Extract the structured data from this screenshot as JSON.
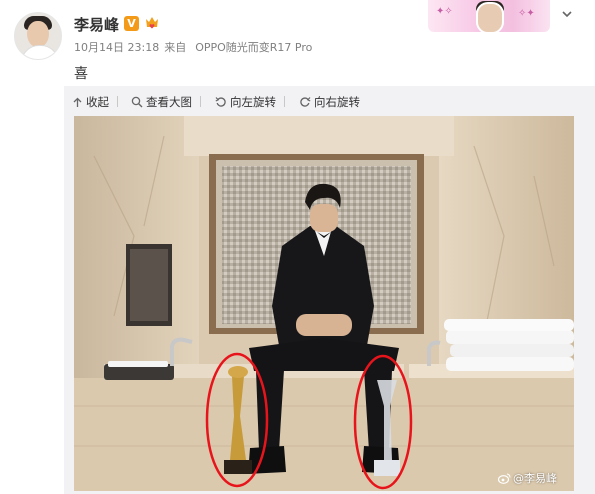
{
  "post": {
    "author_name": "李易峰",
    "verified_badge": "V",
    "timestamp": "10月14日 23:18",
    "source_prefix": "来自",
    "source": "OPPO随光而变R17 Pro",
    "text": "喜"
  },
  "icons": {
    "verified": "verified-v-icon",
    "vip": "crown-heart-icon",
    "more": "chevron-down-icon",
    "collapse": "arrow-up-icon",
    "view_large": "magnifier-icon",
    "rotate_left": "rotate-left-icon",
    "rotate_right": "rotate-right-icon",
    "watermark_logo": "weibo-logo-icon"
  },
  "toolbar": {
    "collapse": "收起",
    "view_large": "查看大图",
    "rotate_left": "向左旋转",
    "rotate_right": "向右旋转"
  },
  "photo": {
    "watermark": "@李易峰",
    "annotation_color": "#e8141c"
  },
  "colors": {
    "badge_orange": "#f39b19",
    "meta_gray": "#808080",
    "text": "#333333",
    "media_bg": "#f2f2f5"
  }
}
